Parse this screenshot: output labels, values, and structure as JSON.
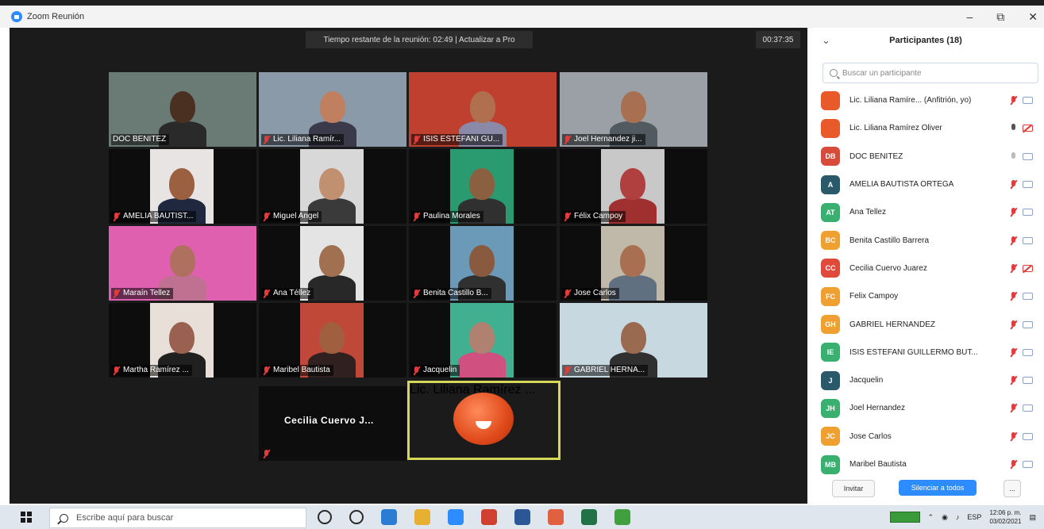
{
  "window": {
    "title": "Zoom Reunión",
    "controls": [
      "–",
      "⧉",
      "✕"
    ]
  },
  "meeting": {
    "banner": "Tiempo restante de la reunión: 02:49 | Actualizar a Pro",
    "timer": "00:37:35"
  },
  "tiles": [
    {
      "name": "DOC BENITEZ",
      "muted": false,
      "bg": "#6a7a74",
      "skin": "#4a3020",
      "shirt": "#2a2a2a"
    },
    {
      "name": "Lic. Liliana Ramír...",
      "muted": true,
      "bg": "#8a9aa8",
      "skin": "#c08060",
      "shirt": "#3a3a4a"
    },
    {
      "name": "ISIS ESTEFANI GU...",
      "muted": true,
      "bg": "#c04030",
      "skin": "#b07050",
      "shirt": "#8a8aa8"
    },
    {
      "name": "Joel Hernandez ji...",
      "muted": true,
      "bg": "#9aa0a6",
      "skin": "#a87050",
      "shirt": "#505a60"
    },
    {
      "name": "AMELIA BAUTIST...",
      "muted": true,
      "bg": "#e8e4e4",
      "skin": "#9a6040",
      "shirt": "#202840"
    },
    {
      "name": "Miguel Angel",
      "muted": true,
      "bg": "#d8d8d8",
      "skin": "#c09070",
      "shirt": "#3a3a3a"
    },
    {
      "name": "Paulina Morales",
      "muted": true,
      "bg": "#2a9a70",
      "skin": "#8a6040",
      "shirt": "#303030"
    },
    {
      "name": "Félix Campoy",
      "muted": true,
      "bg": "#c8c8c8",
      "skin": "#b04040",
      "shirt": "#a03030"
    },
    {
      "name": "Maraín Tellez",
      "muted": true,
      "bg": "#e060b0",
      "skin": "#b07060",
      "shirt": "#c07090"
    },
    {
      "name": "Ana Téllez",
      "muted": true,
      "bg": "#e4e4e4",
      "skin": "#a07050",
      "shirt": "#282828"
    },
    {
      "name": "Benita Castillo B...",
      "muted": true,
      "bg": "#6a9ab8",
      "skin": "#8a5a40",
      "shirt": "#303030"
    },
    {
      "name": "Jose Carlos",
      "muted": true,
      "bg": "#c0b8a8",
      "skin": "#a87050",
      "shirt": "#607080"
    },
    {
      "name": "Martha Ramírez ...",
      "muted": true,
      "bg": "#e8e0d8",
      "skin": "#9a6050",
      "shirt": "#202020"
    },
    {
      "name": "Maribel Bautista",
      "muted": true,
      "bg": "#c04838",
      "skin": "#a06040",
      "shirt": "#302020"
    },
    {
      "name": "Jacquelin",
      "muted": true,
      "bg": "#40b090",
      "skin": "#b08070",
      "shirt": "#d05080"
    },
    {
      "name": "GABRIEL HERNA...",
      "muted": true,
      "bg": "#c8d8e0",
      "skin": "#9a6a50",
      "shirt": "#303030"
    }
  ],
  "name_tile": {
    "name": "Cecilia Cuervo J...",
    "muted": true
  },
  "active_tile": {
    "name": "Lic. Liliana Ramírez ...",
    "muted": false
  },
  "panel": {
    "title": "Participantes (18)",
    "search_placeholder": "Buscar un participante",
    "participants": [
      {
        "initials": "",
        "name": "Lic. Liliana Ramíre... (Anfitrión, yo)",
        "color": "#e85a2a",
        "mic": "muted",
        "cam": "on"
      },
      {
        "initials": "",
        "name": "Lic. Liliana Ramírez Oliver",
        "color": "#e85a2a",
        "mic": "on",
        "cam": "off"
      },
      {
        "initials": "DB",
        "name": "DOC BENITEZ",
        "color": "#d84a3a",
        "mic": "dim",
        "cam": "on"
      },
      {
        "initials": "A",
        "name": "AMELIA BAUTISTA ORTEGA",
        "color": "#2a5a6a",
        "mic": "muted",
        "cam": "on"
      },
      {
        "initials": "AT",
        "name": "Ana Tellez",
        "color": "#3ab070",
        "mic": "muted",
        "cam": "on"
      },
      {
        "initials": "BC",
        "name": "Benita Castillo Barrera",
        "color": "#f0a030",
        "mic": "muted",
        "cam": "on"
      },
      {
        "initials": "CC",
        "name": "Cecilia Cuervo Juarez",
        "color": "#e04a3a",
        "mic": "muted",
        "cam": "off"
      },
      {
        "initials": "FC",
        "name": "Felix Campoy",
        "color": "#f0a030",
        "mic": "muted",
        "cam": "on"
      },
      {
        "initials": "GH",
        "name": "GABRIEL HERNANDEZ",
        "color": "#f0a030",
        "mic": "muted",
        "cam": "on"
      },
      {
        "initials": "IE",
        "name": "ISIS ESTEFANI GUILLERMO BUT...",
        "color": "#3ab070",
        "mic": "muted",
        "cam": "on"
      },
      {
        "initials": "J",
        "name": "Jacquelin",
        "color": "#2a5a6a",
        "mic": "muted",
        "cam": "on"
      },
      {
        "initials": "JH",
        "name": "Joel Hernandez",
        "color": "#3ab070",
        "mic": "muted",
        "cam": "on"
      },
      {
        "initials": "JC",
        "name": "Jose Carlos",
        "color": "#f0a030",
        "mic": "muted",
        "cam": "on"
      },
      {
        "initials": "MB",
        "name": "Maribel Bautista",
        "color": "#3ab070",
        "mic": "muted",
        "cam": "on"
      }
    ],
    "invite_label": "Invitar",
    "mute_all_label": "Silenciar a todos",
    "more_label": "..."
  },
  "taskbar": {
    "search_placeholder": "Escribe aquí para buscar",
    "apps": [
      {
        "icon": "cortana-icon",
        "color": "#2a2a2a"
      },
      {
        "icon": "task-view-icon",
        "color": "#2a2a2a"
      },
      {
        "icon": "edge-icon",
        "color": "#2b7cd3"
      },
      {
        "icon": "file-explorer-icon",
        "color": "#e8b030"
      },
      {
        "icon": "zoom-icon",
        "color": "#2d8cff"
      },
      {
        "icon": "chrome-icon",
        "color": "#d04030"
      },
      {
        "icon": "word-icon",
        "color": "#2b5797"
      },
      {
        "icon": "paint-icon",
        "color": "#e06040"
      },
      {
        "icon": "excel-icon",
        "color": "#217346"
      },
      {
        "icon": "maps-icon",
        "color": "#40a040"
      }
    ],
    "lang": "ESP",
    "time": "12:06 p. m.",
    "date": "03/02/2021"
  }
}
